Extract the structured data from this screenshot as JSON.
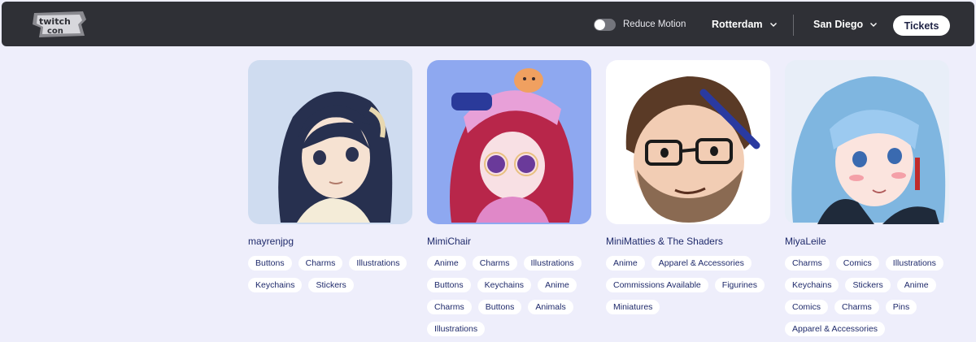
{
  "nav": {
    "logo_text": "twitch con",
    "reduce_motion_label": "Reduce Motion",
    "city_1": "Rotterdam",
    "city_2": "San Diego",
    "tickets_label": "Tickets"
  },
  "creators": [
    {
      "name": "mayrenjpg",
      "tags": [
        "Buttons",
        "Charms",
        "Illustrations",
        "Keychains",
        "Stickers"
      ]
    },
    {
      "name": "MimiChair",
      "tags": [
        "Anime",
        "Charms",
        "Illustrations",
        "Buttons",
        "Keychains",
        "Anime",
        "Charms",
        "Buttons",
        "Animals",
        "Illustrations"
      ]
    },
    {
      "name": "MiniMatties & The Shaders",
      "tags": [
        "Anime",
        "Apparel & Accessories",
        "Commissions Available",
        "Figurines",
        "Miniatures"
      ]
    },
    {
      "name": "MiyaLeile",
      "tags": [
        "Charms",
        "Comics",
        "Illustrations",
        "Keychains",
        "Stickers",
        "Anime",
        "Comics",
        "Charms",
        "Pins",
        "Apparel & Accessories"
      ]
    }
  ],
  "colors": {
    "page_bg": "#eeeefb",
    "nav_bg": "#2f3036",
    "tag_bg": "#ffffff",
    "text": "#1f2a6b"
  }
}
